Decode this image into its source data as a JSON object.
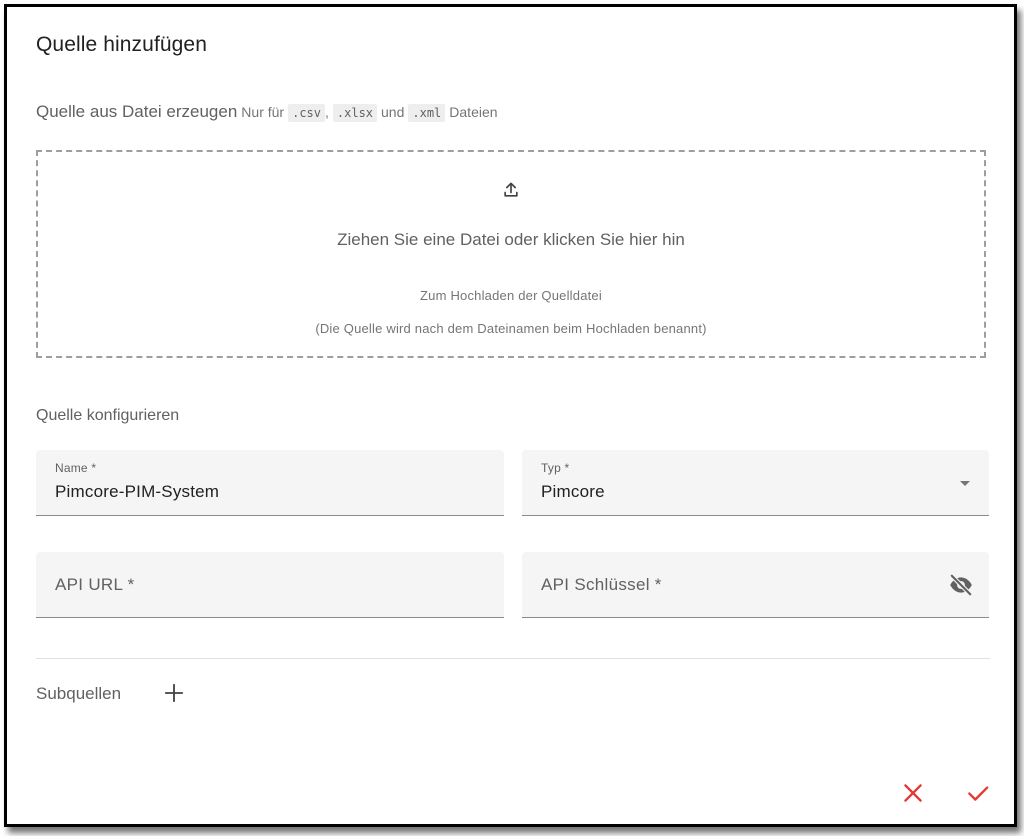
{
  "dialog": {
    "title": "Quelle hinzufügen"
  },
  "upload": {
    "heading": "Quelle aus Datei erzeugen",
    "hint_prefix": "Nur für",
    "formats": [
      ".csv",
      ".xlsx",
      ".xml"
    ],
    "separator_comma": ",",
    "hint_and": "und",
    "hint_suffix": "Dateien",
    "icon": "upload-icon",
    "dropzone_main": "Ziehen Sie eine Datei oder klicken Sie hier hin",
    "dropzone_sub1": "Zum Hochladen der Quelldatei",
    "dropzone_sub2": "(Die Quelle wird nach dem Dateinamen beim Hochladen benannt)"
  },
  "config": {
    "section_label": "Quelle konfigurieren",
    "name_field": {
      "label": "Name *",
      "value": "Pimcore-PIM-System"
    },
    "type_field": {
      "label": "Typ *",
      "value": "Pimcore",
      "icon": "chevron-down-icon"
    },
    "api_url_field": {
      "placeholder": "API URL *",
      "value": ""
    },
    "api_key_field": {
      "placeholder": "API Schlüssel *",
      "value": "",
      "icon": "visibility-off-icon"
    }
  },
  "subsources": {
    "label": "Subquellen",
    "add_icon": "plus-icon"
  },
  "actions": {
    "cancel_icon": "close-icon",
    "confirm_icon": "check-icon",
    "accent_color": "#e53935"
  }
}
